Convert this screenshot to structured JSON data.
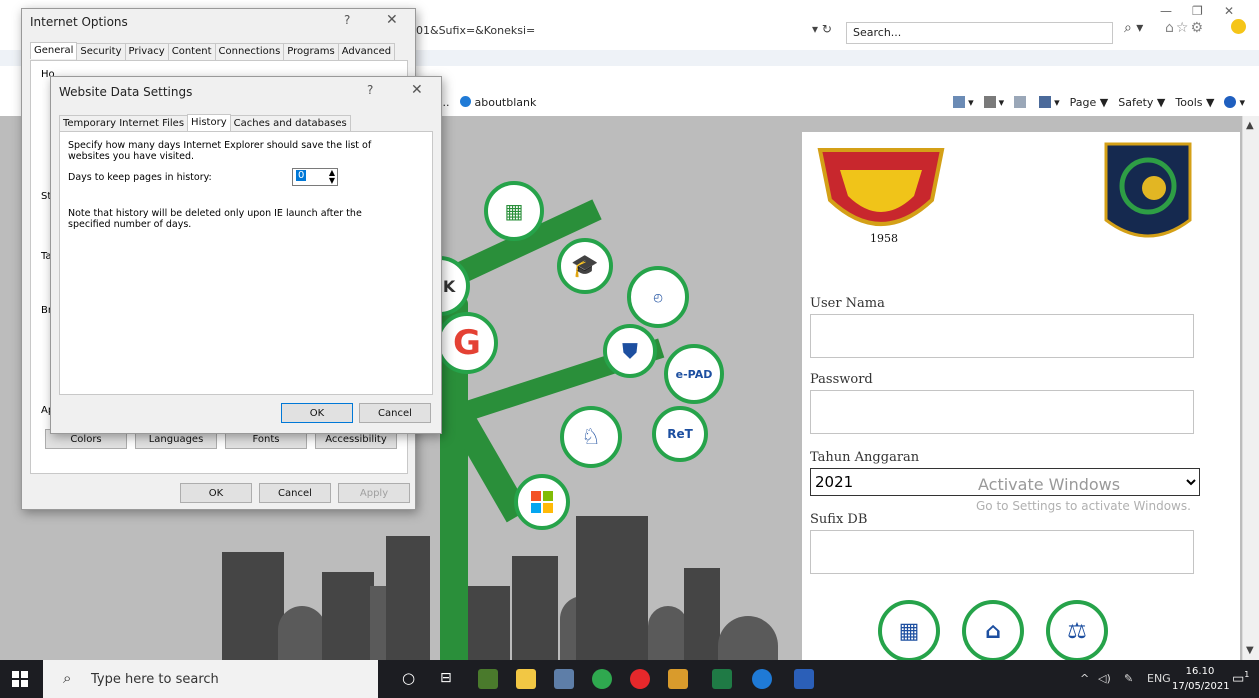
{
  "browser": {
    "address_fragment": "01&Sufix=&Koneksi=",
    "search_placeholder": "Search...",
    "favorite_item": "aboutblank",
    "favorite_prefix": "1...",
    "command_bar": [
      "Page ▼",
      "Safety ▼",
      "Tools ▼"
    ]
  },
  "login": {
    "user_label": "User Nama",
    "password_label": "Password",
    "year_label": "Tahun Anggaran",
    "year_value": "2021",
    "sufix_label": "Sufix DB",
    "emblem_left_year": "1958"
  },
  "watermark": {
    "line1": "Activate Windows",
    "line2": "Go to Settings to activate Windows."
  },
  "tree_labels": {
    "bk": "BK",
    "pad": "e-PAD",
    "ret": "ReT"
  },
  "internet_options": {
    "title": "Internet Options",
    "tabs": [
      "General",
      "Security",
      "Privacy",
      "Content",
      "Connections",
      "Programs",
      "Advanced"
    ],
    "active_tab": "General",
    "side_letters": [
      "Ho",
      "St",
      "Ta",
      "Br",
      "Ap"
    ],
    "buttons": {
      "colors": "Colors",
      "languages": "Languages",
      "fonts": "Fonts",
      "accessibility": "Accessibility",
      "ok": "OK",
      "cancel": "Cancel",
      "apply": "Apply"
    }
  },
  "website_data_settings": {
    "title": "Website Data Settings",
    "tabs": [
      "Temporary Internet Files",
      "History",
      "Caches and databases"
    ],
    "active_tab": "History",
    "description": "Specify how many days Internet Explorer should save the list of websites you have visited.",
    "days_label": "Days to keep pages in history:",
    "days_value": "0",
    "note": "Note that history will be deleted only upon IE launch after the specified number of days.",
    "ok": "OK",
    "cancel": "Cancel"
  },
  "taskbar": {
    "search_placeholder": "Type here to search",
    "time": "16.10",
    "date": "17/05/2021",
    "language": "ENG",
    "notification_count": "1"
  }
}
